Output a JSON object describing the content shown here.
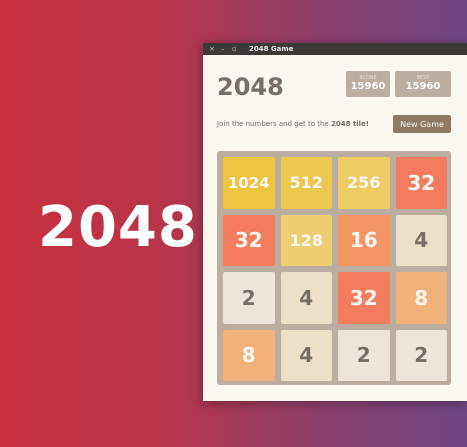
{
  "hero": {
    "text": "2048"
  },
  "window": {
    "title": "2048 Game",
    "controls": {
      "close": "×",
      "minimize": "–",
      "maximize": "▫"
    }
  },
  "game": {
    "brand": "2048",
    "score": {
      "label": "SCORE",
      "value": "15960"
    },
    "best": {
      "label": "BEST",
      "value": "15960"
    },
    "intro_prefix": "Join the numbers and get to the ",
    "intro_bold": "2048 tile!",
    "new_game_label": "New Game"
  },
  "board": {
    "rows": [
      [
        "1024",
        "512",
        "256",
        "32"
      ],
      [
        "32",
        "128",
        "16",
        "4"
      ],
      [
        "2",
        "4",
        "32",
        "8"
      ],
      [
        "8",
        "4",
        "2",
        "2"
      ]
    ]
  },
  "tile_colors": {
    "2": {
      "bg": "#eee4da",
      "fg": "#776e65"
    },
    "4": {
      "bg": "#ede0c8",
      "fg": "#776e65"
    },
    "8": {
      "bg": "#f2b179",
      "fg": "#f9f6f2"
    },
    "16": {
      "bg": "#f59563",
      "fg": "#f9f6f2"
    },
    "32": {
      "bg": "#f67c5f",
      "fg": "#f9f6f2"
    },
    "128": {
      "bg": "#edcf72",
      "fg": "#f9f6f2"
    },
    "256": {
      "bg": "#edcc61",
      "fg": "#f9f6f2"
    },
    "512": {
      "bg": "#edc850",
      "fg": "#f9f6f2"
    },
    "1024": {
      "bg": "#edc53f",
      "fg": "#f9f6f2"
    }
  }
}
